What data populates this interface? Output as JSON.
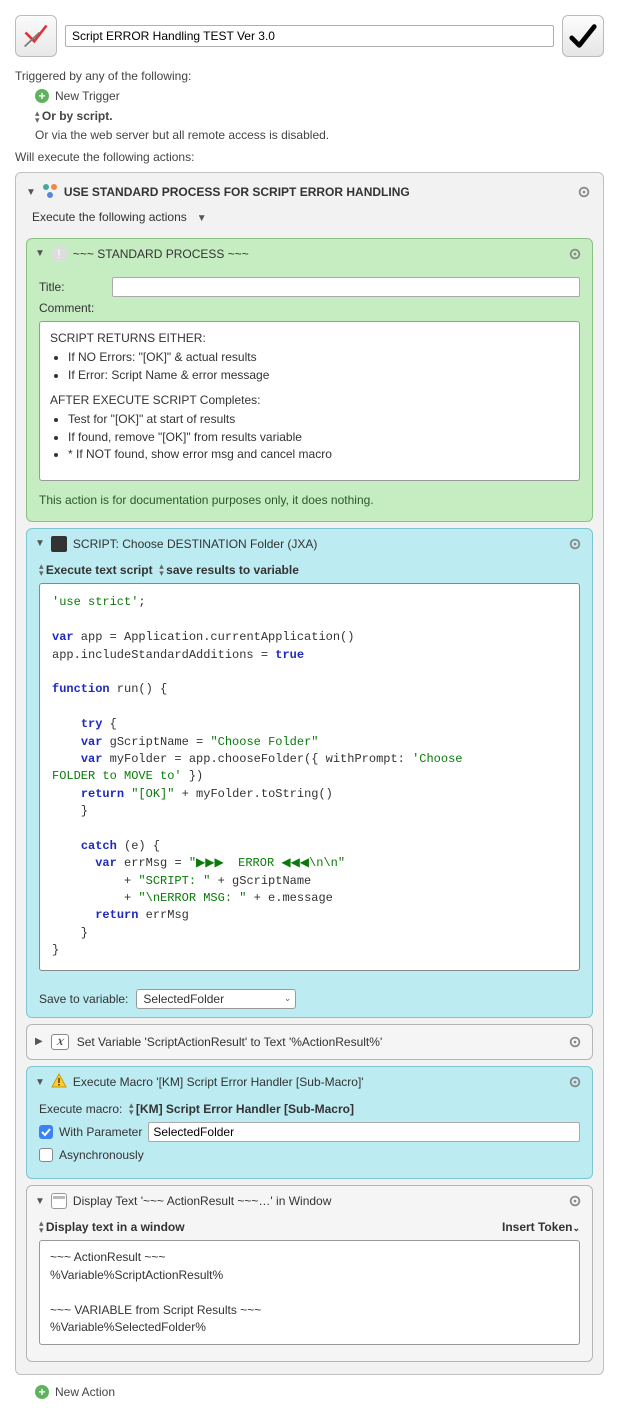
{
  "header": {
    "title": "Script ERROR Handling TEST Ver 3.0"
  },
  "triggers": {
    "label": "Triggered by any of the following:",
    "new_trigger": "New Trigger",
    "or_by_script": "Or by script.",
    "web_server": "Or via the web server but all remote access is disabled."
  },
  "exec_label": "Will execute the following actions:",
  "group": {
    "title": "USE STANDARD PROCESS FOR SCRIPT ERROR HANDLING",
    "following_label": "Execute the following actions"
  },
  "standard": {
    "title": "~~~ STANDARD PROCESS ~~~",
    "title_label": "Title:",
    "title_value": "",
    "comment_label": "Comment:",
    "note": "This action is for documentation purposes only, it does nothing.",
    "comment_lines": {
      "h1": "SCRIPT RETURNS EITHER:",
      "b1": "If NO Errors:  \"[OK]\" & actual results",
      "b2": "If Error:  Script Name & error message",
      "h2": "AFTER EXECUTE SCRIPT Completes:",
      "b3": "Test for \"[OK]\" at start of results",
      "b4": "If found, remove \"[OK]\" from results variable",
      "b5": "* If NOT found, show error msg and cancel macro"
    }
  },
  "script": {
    "title": "SCRIPT: Choose DESTINATION Folder (JXA)",
    "subtitle_left": "Execute text script",
    "subtitle_right": "save results to variable",
    "save_label": "Save to variable:",
    "save_value": "SelectedFolder"
  },
  "setvar": {
    "title": "Set Variable 'ScriptActionResult' to Text '%ActionResult%'"
  },
  "execmacro": {
    "title": "Execute Macro '[KM] Script Error Handler [Sub-Macro]'",
    "row_label": "Execute macro:",
    "row_value": "[KM] Script Error Handler [Sub-Macro]",
    "with_param_label": "With Parameter",
    "param_value": "SelectedFolder",
    "async_label": "Asynchronously"
  },
  "display": {
    "title": "Display Text '~~~ ActionResult ~~~…' in Window",
    "mode": "Display text in a window",
    "token": "Insert Token",
    "content": "~~~ ActionResult ~~~\n%Variable%ScriptActionResult%\n\n~~~ VARIABLE from Script Results ~~~\n%Variable%SelectedFolder%"
  },
  "footer": {
    "new_action": "New Action"
  },
  "chart_data": null
}
